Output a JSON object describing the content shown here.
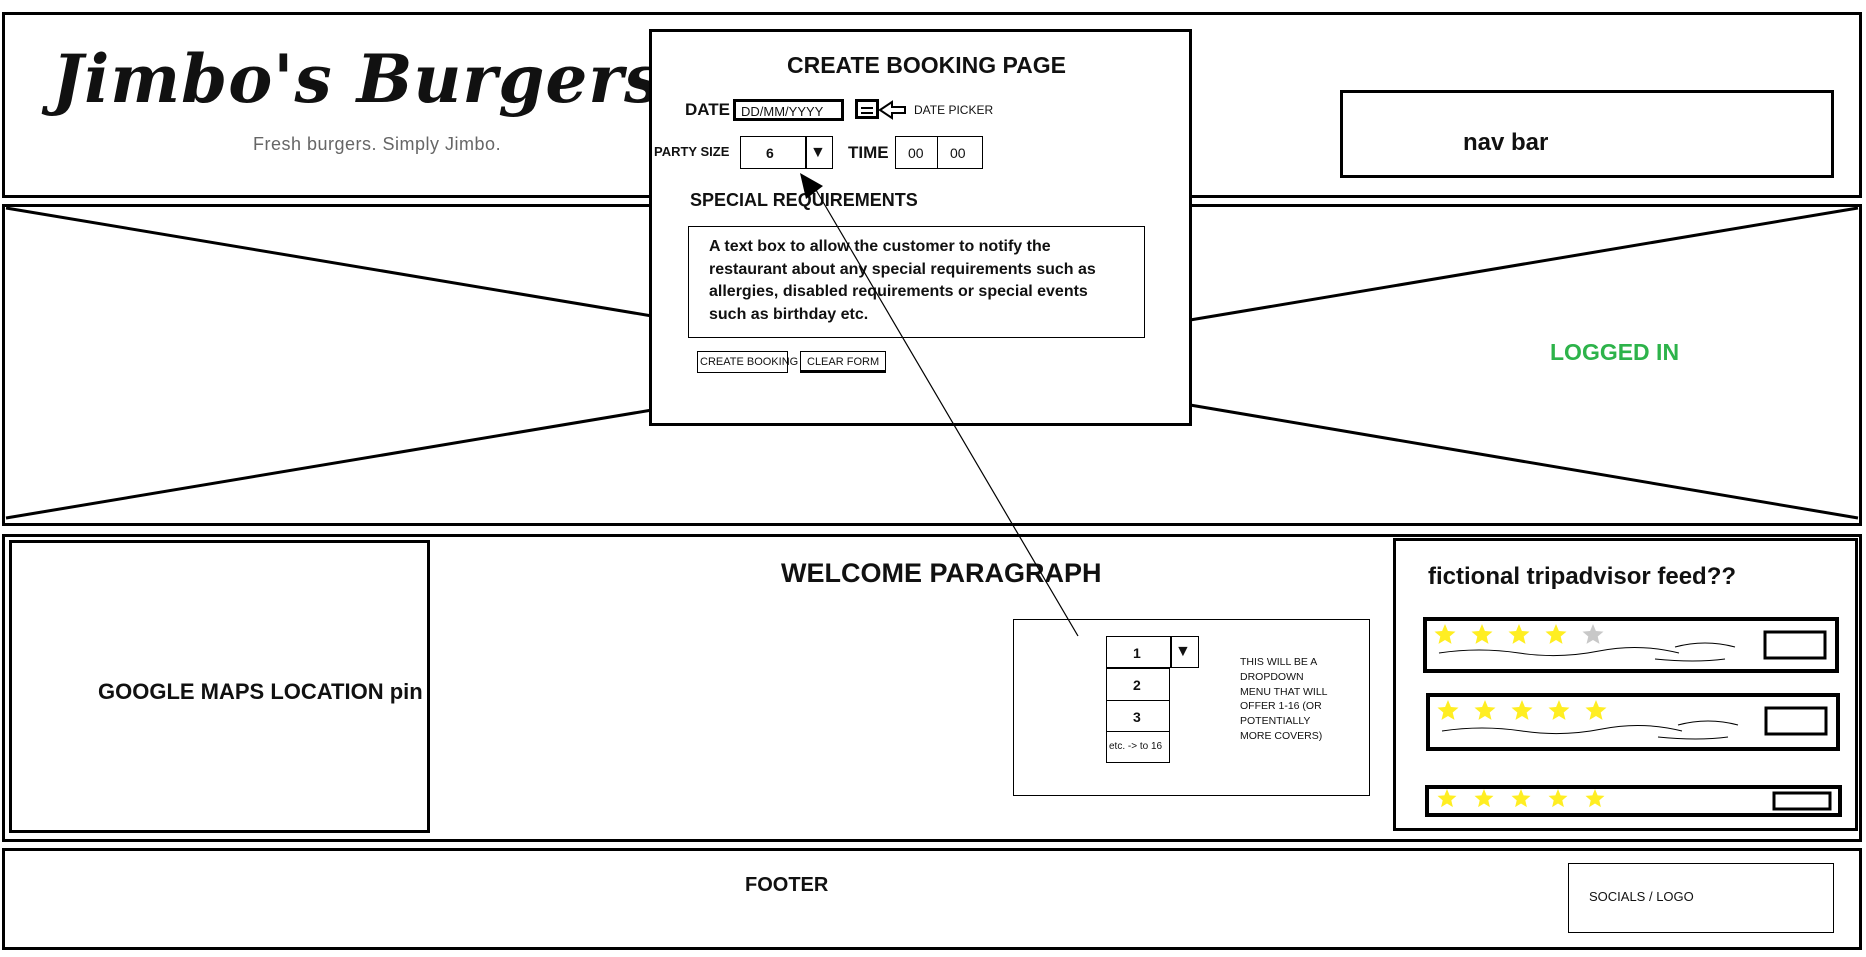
{
  "header": {
    "brand": "Jimbo's Burgers",
    "tagline": "Fresh burgers. Simply Jimbo.",
    "nav_label": "nav bar"
  },
  "booking": {
    "title": "CREATE BOOKING PAGE",
    "date_label": "DATE",
    "date_placeholder": "DD/MM/YYYY",
    "date_picker_note": "DATE PICKER",
    "party_size_label": "PARTY SIZE",
    "party_size_value": "6",
    "time_label": "TIME",
    "time_hours": "00",
    "time_minutes": "00",
    "special_req_label": "SPECIAL REQUIREMENTS",
    "special_req_text": "A text box to allow the customer to notify the restaurant about any special requirements such as allergies, disabled requirements or special events such as birthday etc.",
    "create_button": "CREATE BOOKING",
    "clear_button": "CLEAR FORM"
  },
  "hero": {
    "status": "LOGGED IN",
    "status_color": "#2db34a"
  },
  "main": {
    "map_label": "GOOGLE MAPS LOCATION pin",
    "welcome_title": "WELCOME PARAGRAPH",
    "dropdown_options": [
      "1",
      "2",
      "3",
      "etc. -> to 16"
    ],
    "dropdown_note": "THIS WILL BE A DROPDOWN MENU THAT WILL OFFER 1-16 (OR POTENTIALLY MORE COVERS)"
  },
  "feed": {
    "title": "fictional tripadvisor feed??",
    "reviews": [
      {
        "stars": 4,
        "out_of": 5
      },
      {
        "stars": 5,
        "out_of": 5
      },
      {
        "stars": 5,
        "out_of": 5
      }
    ],
    "star_color": "#ffee22"
  },
  "footer": {
    "label": "FOOTER",
    "socials": "SOCIALS / LOGO"
  }
}
